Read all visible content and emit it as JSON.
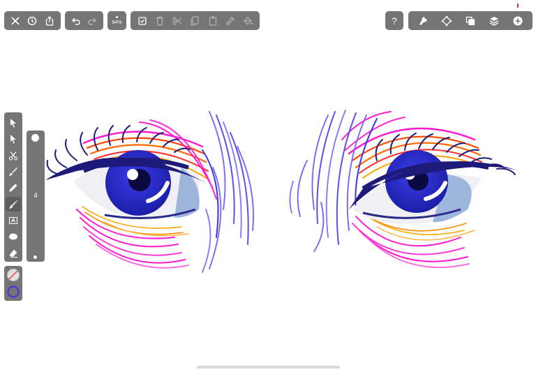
{
  "app": {
    "zoom": "84%",
    "brush_size": "4",
    "colors": {
      "toolbar_bg": "#757575",
      "fill_color": "none",
      "stroke_color": "#4b3ad6"
    }
  },
  "toolbar_left": {
    "file_group": [
      "close-icon",
      "history-icon",
      "share-icon"
    ],
    "history_group": [
      "undo-icon",
      "redo-icon"
    ],
    "edit_group": [
      "select-all-icon",
      "delete-icon",
      "cut-icon",
      "copy-icon",
      "paste-icon",
      "eyedropper-icon",
      "paint-bucket-icon"
    ]
  },
  "toolbar_right": {
    "help_label": "?",
    "panel_group": [
      "pen-settings-icon",
      "transform-icon",
      "boolean-icon",
      "layers-icon",
      "add-icon"
    ]
  },
  "tools": [
    {
      "name": "selection-tool",
      "icon": "arrow-icon"
    },
    {
      "name": "direct-selection-tool",
      "icon": "node-arrow-icon"
    },
    {
      "name": "scissors-tool",
      "icon": "scissors-icon"
    },
    {
      "name": "brush-tool",
      "icon": "brush-icon"
    },
    {
      "name": "pencil-tool",
      "icon": "pencil-icon"
    },
    {
      "name": "paintbrush-tool",
      "icon": "paintbrush-icon",
      "active": true
    },
    {
      "name": "text-tool",
      "icon": "text-box-icon"
    },
    {
      "name": "ellipse-tool",
      "icon": "ellipse-icon"
    },
    {
      "name": "eraser-tool",
      "icon": "eraser-icon"
    }
  ]
}
